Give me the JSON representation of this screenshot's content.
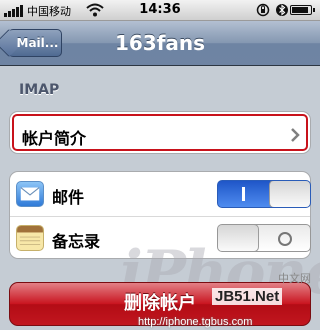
{
  "status_bar": {
    "carrier": "中国移动",
    "time": "14:36",
    "signal_bars": 5,
    "battery_level": 0.9,
    "icons": [
      "signal-bars-icon",
      "wifi-icon",
      "rotation-lock-icon",
      "bluetooth-icon",
      "battery-icon"
    ]
  },
  "nav": {
    "back_label": "Mail...",
    "title": "163fans"
  },
  "section": {
    "header": "IMAP",
    "account_info_label": "帐户简介",
    "account_chevron_icon": "chevron-right-icon"
  },
  "apps": [
    {
      "label": "邮件",
      "icon": "mail-icon",
      "enabled": true
    },
    {
      "label": "备忘录",
      "icon": "notes-icon",
      "enabled": false
    }
  ],
  "delete_button": {
    "label": "删除帐户"
  },
  "watermark": {
    "logo": "iPhone",
    "site": "JB51.Net",
    "site_cn": "中文网",
    "url": "http://iphone.tgbus.com"
  },
  "colors": {
    "background": "#c5ccd4",
    "nav_bar": "#6e84a3",
    "switch_on": "#2f6fe0",
    "delete_button": "#c9141f",
    "highlight_border": "#c8121b"
  }
}
